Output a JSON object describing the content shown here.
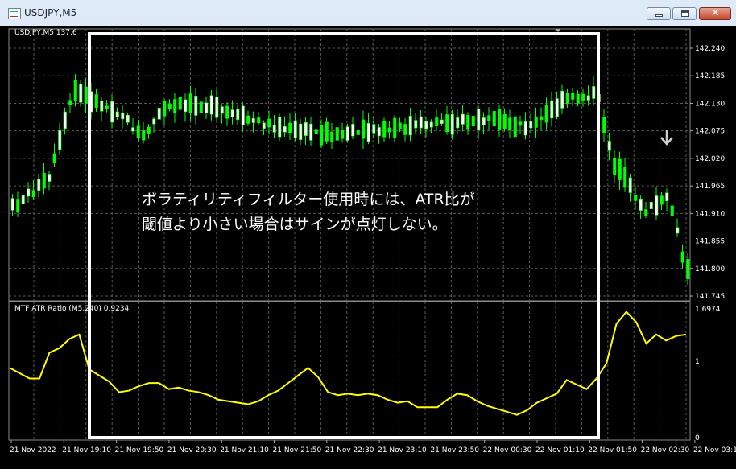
{
  "window": {
    "title": "USDJPY,M5",
    "close_glyph": "✕"
  },
  "main_chart": {
    "label": "USDJPY,M5  137.6",
    "price_labels": [
      "142.240",
      "142.185",
      "142.130",
      "142.075",
      "142.020",
      "141.965",
      "141.910",
      "141.855",
      "141.800",
      "141.745"
    ],
    "annotation": [
      "ボラティリティフィルター使用時には、ATR比が",
      "閾値より小さい場合はサインが点灯しない。"
    ]
  },
  "indicator": {
    "label": "MTF ATR Ratio  (M5,240) 0.9234",
    "scale_labels": [
      "1.6974",
      "1",
      "0"
    ],
    "color": "#ffff00"
  },
  "time_labels": [
    "21 Nov 2022",
    "21 Nov 19:10",
    "21 Nov 19:50",
    "21 Nov 20:30",
    "21 Nov 21:10",
    "21 Nov 21:50",
    "21 Nov 22:30",
    "21 Nov 23:10",
    "21 Nov 23:50",
    "22 Nov 00:30",
    "22 Nov 01:10",
    "22 Nov 01:50",
    "22 Nov 02:30",
    "22 Nov 03:10"
  ],
  "colors": {
    "bull": "#ffffff",
    "bear": "#00ff00",
    "grid": "#5a5a5a",
    "highlight_box": "#ffffff",
    "signal_arrow": "#d0d0d0"
  },
  "chart_data": {
    "type": "line",
    "title": "",
    "series": [
      {
        "name": "MTF ATR Ratio",
        "values": [
          0.92,
          0.85,
          0.78,
          0.78,
          1.12,
          1.18,
          1.3,
          1.36,
          0.9,
          0.82,
          0.74,
          0.6,
          0.62,
          0.68,
          0.72,
          0.72,
          0.64,
          0.66,
          0.62,
          0.6,
          0.56,
          0.5,
          0.48,
          0.46,
          0.44,
          0.48,
          0.56,
          0.62,
          0.72,
          0.82,
          0.92,
          0.8,
          0.6,
          0.56,
          0.58,
          0.56,
          0.58,
          0.56,
          0.5,
          0.46,
          0.48,
          0.4,
          0.4,
          0.4,
          0.5,
          0.58,
          0.56,
          0.48,
          0.42,
          0.38,
          0.34,
          0.3,
          0.36,
          0.46,
          0.52,
          0.58,
          0.76,
          0.7,
          0.64,
          0.78,
          0.98,
          1.5,
          1.66,
          1.52,
          1.24,
          1.36,
          1.28,
          1.34,
          1.36
        ]
      }
    ],
    "ylim": [
      0,
      1.6974
    ]
  }
}
